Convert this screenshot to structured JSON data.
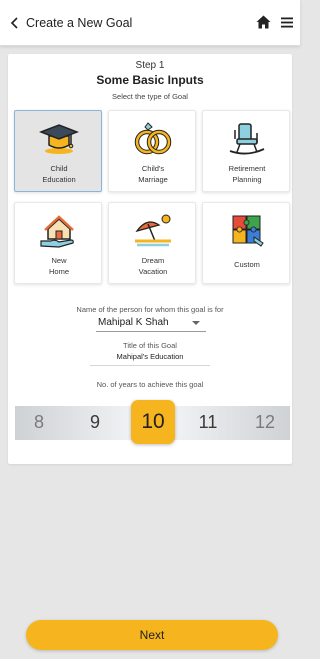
{
  "header": {
    "title": "Create a New Goal",
    "icons": [
      "back-chevron-icon",
      "home-icon",
      "menu-icon"
    ]
  },
  "step": {
    "label": "Step 1",
    "title": "Some Basic Inputs",
    "subtitle": "Select the type of Goal"
  },
  "goal_types": [
    {
      "line1": "Child",
      "line2": "Education",
      "icon": "graduation-cap-icon",
      "selected": true
    },
    {
      "line1": "Child's",
      "line2": "Marriage",
      "icon": "wedding-rings-icon",
      "selected": false
    },
    {
      "line1": "Retirement",
      "line2": "Planning",
      "icon": "rocking-chair-icon",
      "selected": false
    },
    {
      "line1": "New",
      "line2": "Home",
      "icon": "house-hand-icon",
      "selected": false
    },
    {
      "line1": "Dream",
      "line2": "Vacation",
      "icon": "beach-umbrella-icon",
      "selected": false
    },
    {
      "line1": "Custom",
      "line2": "",
      "icon": "puzzle-icon",
      "selected": false
    }
  ],
  "person": {
    "caption": "Name of the person for whom this goal is for",
    "value": "Mahipal K Shah"
  },
  "goal_title": {
    "caption": "Title of this Goal",
    "value": "Mahipal's Education"
  },
  "years": {
    "caption": "No. of years to achieve this goal",
    "options": [
      "8",
      "9",
      "10",
      "11",
      "12"
    ],
    "selected": "10"
  },
  "next_label": "Next",
  "colors": {
    "accent": "#f6b51e",
    "selected_tile": "#e4e4e4",
    "selected_border": "#8ab4dc"
  }
}
